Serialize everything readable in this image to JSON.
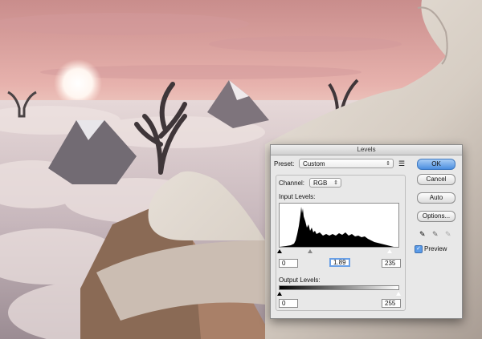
{
  "dialog": {
    "title": "Levels",
    "preset_label": "Preset:",
    "preset_value": "Custom",
    "channel_label": "Channel:",
    "channel_value": "RGB",
    "input_levels_label": "Input Levels:",
    "input_black": "0",
    "input_gamma": "1.89",
    "input_white": "235",
    "output_levels_label": "Output Levels:",
    "output_black": "0",
    "output_white": "255",
    "buttons": {
      "ok": "OK",
      "cancel": "Cancel",
      "auto": "Auto",
      "options": "Options..."
    },
    "preview_label": "Preview",
    "preview_checked": true,
    "icons": [
      "preset-options-icon",
      "black-eyedropper-icon",
      "gray-eyedropper-icon",
      "white-eyedropper-icon"
    ]
  },
  "colors": {
    "ok_accent": "#4a8ee0",
    "dialog_bg": "#e8e8e8"
  }
}
